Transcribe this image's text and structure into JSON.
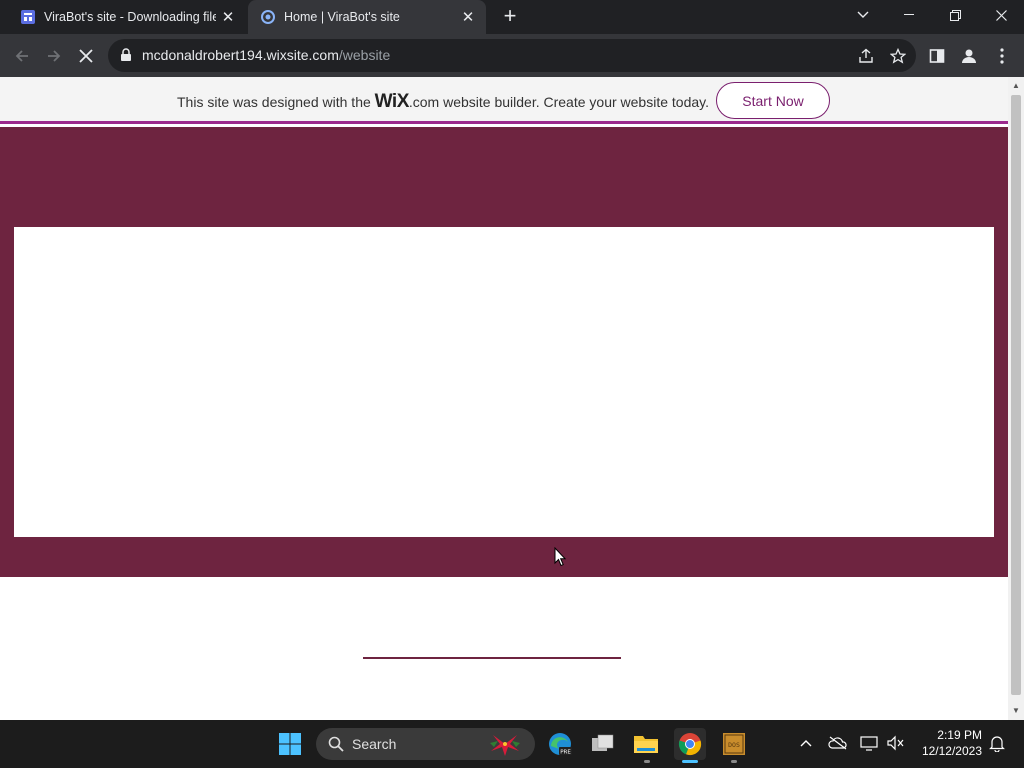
{
  "browser": {
    "tabs": [
      {
        "title": "ViraBot's site - Downloading file",
        "active": false
      },
      {
        "title": "Home | ViraBot's site",
        "active": true
      }
    ],
    "address": {
      "host": "mcdonaldrobert194.wixsite.com",
      "path": "/website"
    }
  },
  "wix_banner": {
    "message_before": "This site was designed with the ",
    "logo_text": "WiX",
    "message_after": ".com website builder. Create your website today.",
    "cta_label": "Start Now"
  },
  "colors": {
    "hero": "#6e2440",
    "accent": "#9b2a8d",
    "cta": "#7a1f6e"
  },
  "taskbar": {
    "search_label": "Search",
    "time": "2:19 PM",
    "date": "12/12/2023"
  }
}
